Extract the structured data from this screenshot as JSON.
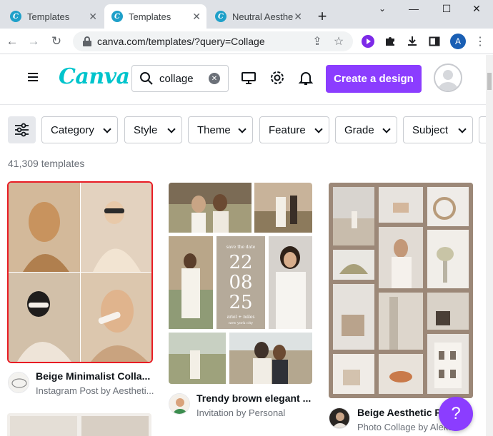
{
  "browser": {
    "tabs": [
      {
        "label": "Templates",
        "active": false
      },
      {
        "label": "Templates",
        "active": true
      },
      {
        "label": "Neutral Aesthe",
        "active": false
      }
    ],
    "url": "canva.com/templates/?query=Collage",
    "profile_initial": "A"
  },
  "header": {
    "logo": "Canva",
    "search_value": "collage",
    "create_label": "Create a design"
  },
  "filters": [
    "Category",
    "Style",
    "Theme",
    "Feature",
    "Grade",
    "Subject"
  ],
  "results_count": "41,309 templates",
  "cards": [
    {
      "title": "Beige Minimalist Colla...",
      "subtitle": "Instagram Post by Aestheti...",
      "selected": true
    },
    {
      "title": "Trendy brown elegant ...",
      "subtitle": "Invitation by Personal",
      "selected": false
    },
    {
      "title": "Beige Aesthetic P...",
      "subtitle": "Photo Collage by Aleks...",
      "selected": false
    }
  ],
  "invitation": {
    "line1": "save the date",
    "day": "22",
    "month": "08",
    "year": "25",
    "names": "ariel + miles",
    "place": "new york city"
  },
  "help_label": "?",
  "colors": {
    "accent": "#8b3dff",
    "selection": "#e81c24",
    "teal": "#00c4cc"
  }
}
